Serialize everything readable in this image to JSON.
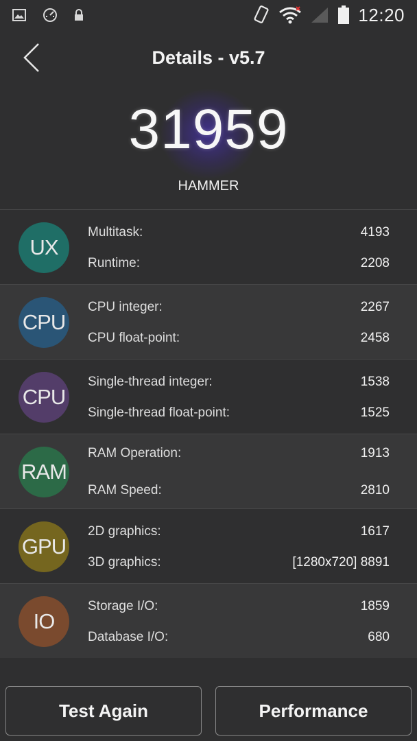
{
  "status_bar": {
    "time": "12:20",
    "icons": [
      "image-icon",
      "speedometer-icon",
      "lock-icon",
      "screen-rotate-icon",
      "wifi-icon",
      "signal-icon",
      "battery-icon"
    ]
  },
  "header": {
    "title": "Details - v5.7",
    "back_icon": "chevron-left-icon"
  },
  "score": {
    "value": "31959",
    "device": "HAMMER"
  },
  "categories": [
    {
      "badge": "UX",
      "color": "#1f6e66",
      "items": [
        {
          "label": "Multitask:",
          "value": "4193"
        },
        {
          "label": "Runtime:",
          "value": "2208"
        }
      ]
    },
    {
      "badge": "CPU",
      "color": "#2a5576",
      "items": [
        {
          "label": "CPU integer:",
          "value": "2267"
        },
        {
          "label": "CPU float-point:",
          "value": "2458"
        }
      ]
    },
    {
      "badge": "CPU",
      "color": "#533d69",
      "items": [
        {
          "label": "Single-thread integer:",
          "value": "1538"
        },
        {
          "label": "Single-thread float-point:",
          "value": "1525"
        }
      ]
    },
    {
      "badge": "RAM",
      "color": "#2c6a47",
      "items": [
        {
          "label": "RAM Operation:",
          "value": "1913"
        },
        {
          "label": "RAM Speed:",
          "value": "2810"
        }
      ]
    },
    {
      "badge": "GPU",
      "color": "#75661f",
      "items": [
        {
          "label": "2D graphics:",
          "value": "1617"
        },
        {
          "label": "3D graphics:",
          "value": "[1280x720] 8891"
        }
      ]
    },
    {
      "badge": "IO",
      "color": "#7a4a2e",
      "items": [
        {
          "label": "Storage I/O:",
          "value": "1859"
        },
        {
          "label": "Database I/O:",
          "value": "680"
        }
      ]
    }
  ],
  "buttons": {
    "test_again": "Test Again",
    "performance": "Performance"
  }
}
